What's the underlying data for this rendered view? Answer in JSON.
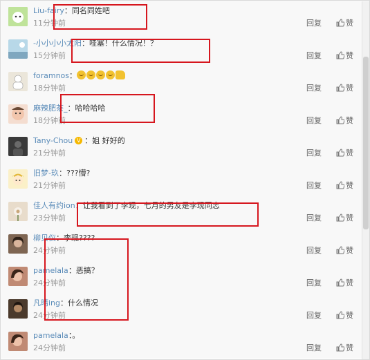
{
  "ui": {
    "reply_label": "回复",
    "like_label": "赞"
  },
  "comments": [
    {
      "name": "Liu-fairy",
      "text": "：同名同姓吧",
      "time": "11分钟前",
      "avatar": "cat-green-avatar",
      "avatar_color": "#8fc46a"
    },
    {
      "name": "-小小小小太阳",
      "text": "：哇塞！什么情况！？",
      "time": "15分钟前",
      "avatar": "sky-blue-avatar",
      "avatar_color": "#9bc4d8"
    },
    {
      "name": "foramnos",
      "text": "：",
      "emojis": "😂😂😂😂👍",
      "time": "18分钟前",
      "avatar": "white-figure-avatar",
      "avatar_color": "#d8d2c4"
    },
    {
      "name": "麻辣肥茶_",
      "text": "：哈哈哈哈",
      "time": "18分钟前",
      "avatar": "child-photo-avatar",
      "avatar_color": "#e7b7a3"
    },
    {
      "name": "Tany-Chou",
      "verified": true,
      "text": "：姐 好好的",
      "time": "21分钟前",
      "avatar": "dark-photo-avatar",
      "avatar_color": "#3d3d3d"
    },
    {
      "name": "旧梦-玖",
      "text": "：???懵?",
      "time": "21分钟前",
      "avatar": "cartoon-boy-avatar",
      "avatar_color": "#f0d98a"
    },
    {
      "name": "佳人有约ion",
      "text": "：让我看到了李现，七月的男友是李现同志",
      "time": "23分钟前",
      "avatar": "flower-avatar",
      "avatar_color": "#d9c3a6"
    },
    {
      "name": "柳贝仪",
      "text": "：李现????",
      "time": "24分钟前",
      "avatar": "woman-photo-avatar",
      "avatar_color": "#8a6f5a"
    },
    {
      "name": "pamelala",
      "text": "：恶搞？",
      "time": "24分钟前",
      "avatar": "woman-photo-avatar",
      "avatar_color": "#b27b68"
    },
    {
      "name": "凡晴ing",
      "text": "：什么情况",
      "time": "24分钟前",
      "avatar": "dark-photo-avatar",
      "avatar_color": "#4e3b2c"
    },
    {
      "name": "pamelala",
      "text": "：。",
      "time": "24分钟前",
      "avatar": "woman-photo-avatar",
      "avatar_color": "#b27b68"
    }
  ]
}
